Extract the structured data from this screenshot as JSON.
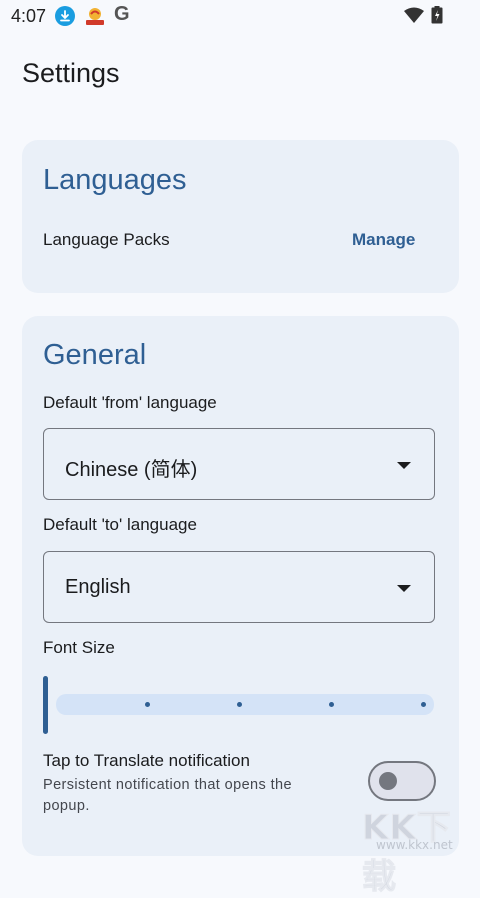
{
  "status_bar": {
    "time": "4:07",
    "icons": [
      "download-icon",
      "app-notification-icon",
      "google-icon",
      "wifi-icon",
      "battery-icon"
    ],
    "google_letter": "G"
  },
  "page": {
    "title": "Settings"
  },
  "languages": {
    "title": "Languages",
    "language_packs_label": "Language Packs",
    "manage_label": "Manage"
  },
  "general": {
    "title": "General",
    "from_label": "Default 'from' language",
    "from_value": "Chinese (简体)",
    "to_label": "Default 'to' language",
    "to_value": "English",
    "font_size_label": "Font Size",
    "font_size_level": 0,
    "font_size_steps": 5,
    "notification_title": "Tap to Translate notification",
    "notification_desc": "Persistent notification that opens the popup.",
    "notification_enabled": false
  },
  "watermark": {
    "text": "KK下载",
    "url": "www.kkx.net"
  },
  "colors": {
    "accent": "#2f5f93",
    "card_bg": "#eaf0f8",
    "page_bg": "#f7f9fd",
    "track": "#d4e3f7"
  }
}
